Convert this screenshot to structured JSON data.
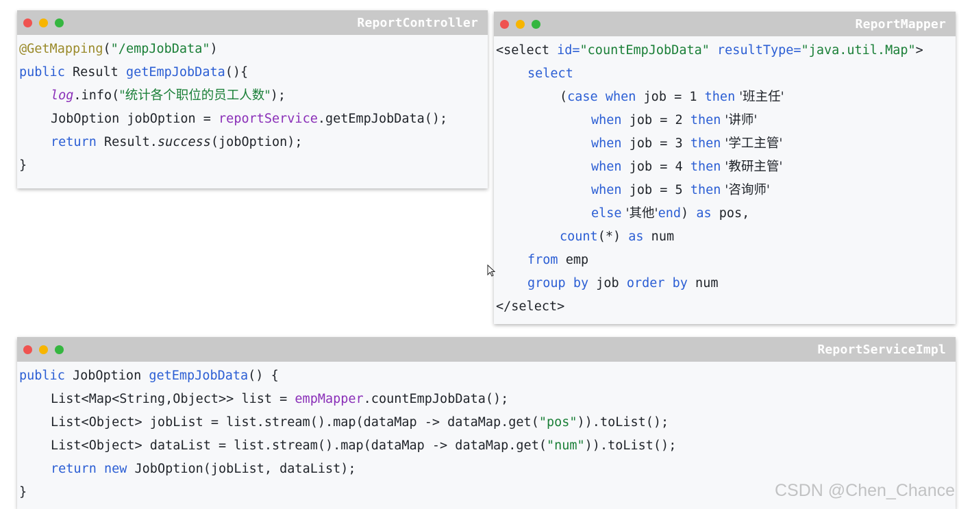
{
  "windows": {
    "controller": {
      "title": "ReportController",
      "lines": [
        "@GetMapping",
        "(",
        "\"/empJobData\"",
        ")",
        "public",
        " Result ",
        "getEmpJobData",
        "(){",
        "log",
        ".info(",
        "\"统计各个职位的员工人数\"",
        ");",
        "JobOption jobOption = ",
        "reportService",
        ".getEmpJobData();",
        "return",
        " Result.",
        "success",
        "(jobOption);",
        "}"
      ]
    },
    "mapper": {
      "title": "ReportMapper",
      "tokens": {
        "open_tag_1": "<select ",
        "attr_id": "id=",
        "attr_id_val": "\"countEmpJobData\"",
        "attr_rt": " resultType=",
        "attr_rt_val": "\"java.util.Map\"",
        "open_tag_2": ">",
        "select_kw": "select",
        "paren": "(",
        "case_kw": "case",
        "when_kw": "when",
        "job_eq_1": " job = 1 ",
        "job_eq_2": " job = 2 ",
        "job_eq_3": " job = 3 ",
        "job_eq_4": " job = 4 ",
        "job_eq_5": " job = 5 ",
        "then_kw": "then",
        "v1": " '班主任'",
        "v2": " '讲师'",
        "v3": " '学工主管'",
        "v4": " '教研主管'",
        "v5": " '咨询师'",
        "else_kw": "else",
        "v_else": " '其他'",
        "end_kw": "end",
        "end_tail": ") ",
        "as_kw": "as",
        "pos_tail": " pos,",
        "count_kw": "count",
        "count_arg": "(*) ",
        "num_tail": " num",
        "from_kw": "from",
        "emp": " emp",
        "group_by": "group by",
        "job_mid": " job ",
        "order_by": "order by",
        "close_tag": "</select>"
      }
    },
    "service": {
      "title": "ReportServiceImpl",
      "tokens": {
        "public": "public",
        "sig1": " JobOption ",
        "method": "getEmpJobData",
        "sig2": "() {",
        "l1a": "List<Map<String,Object>> list = ",
        "l1b": "empMapper",
        "l1c": ".countEmpJobData();",
        "l2a": "List<Object> jobList = list.stream().map(dataMap -> dataMap.get(",
        "l2b": "\"pos\"",
        "l2c": ")).toList();",
        "l3a": "List<Object> dataList = list.stream().map(dataMap -> dataMap.get(",
        "l3b": "\"num\"",
        "l3c": ")).toList();",
        "return": "return",
        "new": "new",
        "l4c": " JobOption(jobList, dataList);",
        "close": "}"
      }
    }
  },
  "watermark": "CSDN @Chen_Chance",
  "icons": {
    "window_close": "red-dot",
    "window_minimize": "yellow-dot",
    "window_maximize": "green-dot",
    "cursor": "mouse-pointer"
  }
}
